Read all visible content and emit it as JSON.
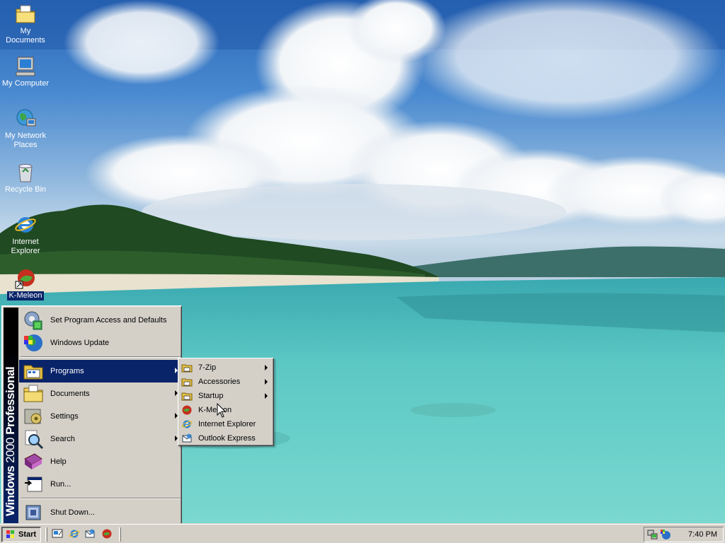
{
  "desktop": {
    "icons": [
      {
        "label": "My Documents",
        "icon": "my-documents-icon"
      },
      {
        "label": "My Computer",
        "icon": "my-computer-icon"
      },
      {
        "label": "My Network Places",
        "icon": "network-places-icon"
      },
      {
        "label": "Recycle Bin",
        "icon": "recycle-bin-icon"
      },
      {
        "label": "Internet Explorer",
        "icon": "internet-explorer-icon"
      },
      {
        "label": "K-Meleon",
        "icon": "k-meleon-icon"
      }
    ]
  },
  "start_menu": {
    "banner_bold": "Windows",
    "banner_normal": "2000",
    "banner_suffix": " Professional",
    "items": [
      {
        "label": "Set Program Access and Defaults",
        "icon": "program-access-icon"
      },
      {
        "label": "Windows Update",
        "icon": "windows-update-icon"
      },
      {
        "label": "Programs",
        "icon": "programs-icon",
        "highlighted": true
      },
      {
        "label": "Documents",
        "icon": "documents-folder-icon"
      },
      {
        "label": "Settings",
        "icon": "settings-icon"
      },
      {
        "label": "Search",
        "icon": "search-icon"
      },
      {
        "label": "Help",
        "icon": "help-icon"
      },
      {
        "label": "Run...",
        "icon": "run-icon"
      },
      {
        "label": "Shut Down...",
        "icon": "shut-down-icon"
      }
    ]
  },
  "programs_menu": {
    "items": [
      {
        "label": "7-Zip",
        "icon": "program-group-icon"
      },
      {
        "label": "Accessories",
        "icon": "program-group-icon"
      },
      {
        "label": "Startup",
        "icon": "program-group-icon"
      },
      {
        "label": "K-Meleon",
        "icon": "k-meleon-icon"
      },
      {
        "label": "Internet Explorer",
        "icon": "internet-explorer-icon"
      },
      {
        "label": "Outlook Express",
        "icon": "outlook-express-icon"
      }
    ]
  },
  "taskbar": {
    "start_label": "Start",
    "clock": "7:40 PM"
  },
  "colors": {
    "highlight": "#0a246a",
    "face": "#d4d0c8"
  }
}
